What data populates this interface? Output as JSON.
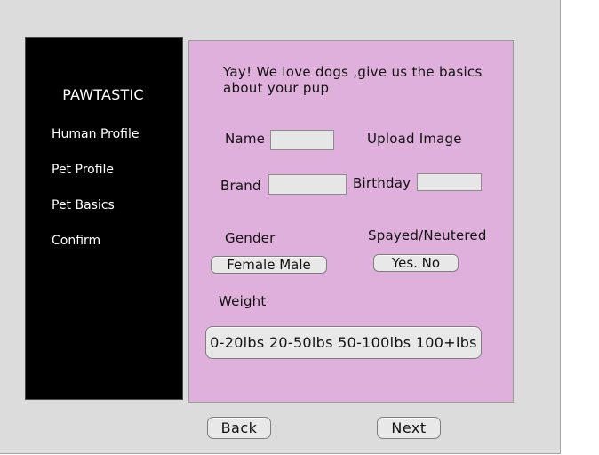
{
  "sidebar": {
    "brand": "PAWTASTIC",
    "items": [
      {
        "label": "Human Profile"
      },
      {
        "label": "Pet Profile"
      },
      {
        "label": "Pet Basics"
      },
      {
        "label": "Confirm"
      }
    ]
  },
  "form": {
    "intro_line1": "Yay! We love dogs ,give us the basics",
    "intro_line2": "about your pup",
    "name_label": "Name",
    "name_value": "",
    "upload_image_label": "Upload Image",
    "brand_label": "Brand",
    "brand_value": "",
    "birthday_label": "Birthday",
    "birthday_value": "",
    "gender_label": "Gender",
    "gender_options": "Female  Male",
    "spayed_label": "Spayed/Neutered",
    "spayed_options": "Yes. No",
    "weight_label": "Weight",
    "weight_options": "0-20lbs 20-50lbs 50-100lbs 100+lbs"
  },
  "footer": {
    "back_label": "Back",
    "next_label": "Next"
  }
}
